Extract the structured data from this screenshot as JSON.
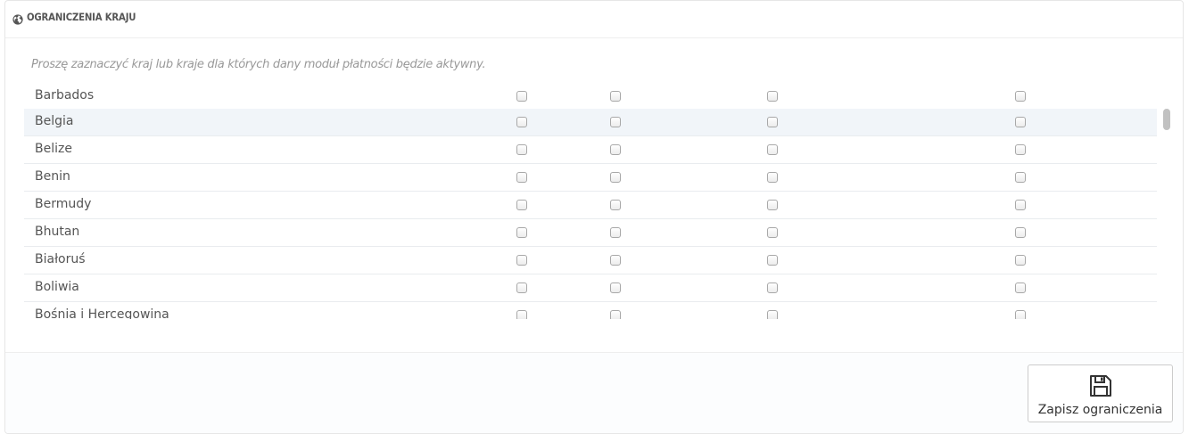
{
  "panel": {
    "heading_icon": "globe-icon",
    "heading_title": "OGRANICZENIA KRAJU",
    "help_text": "Proszę zaznaczyć kraj lub kraje dla których dany moduł płatności będzie aktywny."
  },
  "countries": {
    "rows": [
      {
        "name": "Barbados",
        "highlighted": false
      },
      {
        "name": "Belgia",
        "highlighted": true
      },
      {
        "name": "Belize",
        "highlighted": false
      },
      {
        "name": "Benin",
        "highlighted": false
      },
      {
        "name": "Bermudy",
        "highlighted": false
      },
      {
        "name": "Bhutan",
        "highlighted": false
      },
      {
        "name": "Białoruś",
        "highlighted": false
      },
      {
        "name": "Boliwia",
        "highlighted": false
      },
      {
        "name": "Bośnia i Hercegowina",
        "highlighted": false
      }
    ],
    "checkboxes_per_row": 4,
    "checked": false
  },
  "footer": {
    "save_icon": "floppy-disk-icon",
    "save_label": "Zapisz ograniczenia"
  },
  "colors": {
    "row_highlight": "#f1f5f9",
    "heading_text": "#555555",
    "help_text": "#999999"
  }
}
